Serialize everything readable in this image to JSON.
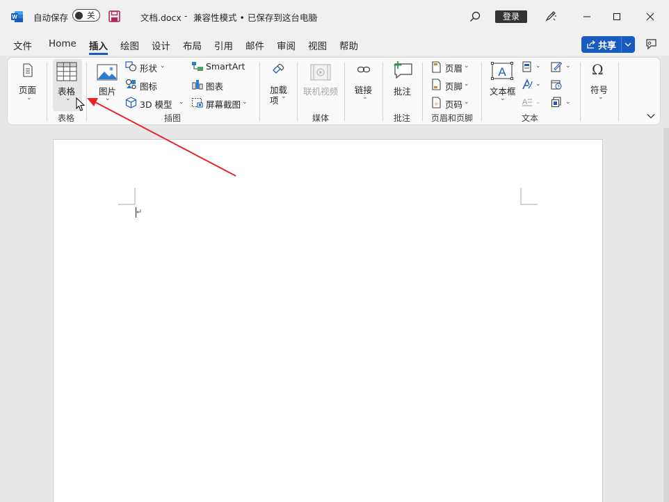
{
  "titlebar": {
    "autosave_label": "自动保存",
    "toggle_state": "关",
    "doc_title": "文档.docx",
    "dash": "-",
    "mode_status": "兼容性模式 • 已保存到这台电脑",
    "login": "登录"
  },
  "menu": {
    "items": [
      "文件",
      "Home",
      "插入",
      "绘图",
      "设计",
      "布局",
      "引用",
      "邮件",
      "审阅",
      "视图",
      "帮助"
    ],
    "active": "插入",
    "share": "共享"
  },
  "ribbon": {
    "pages": {
      "label": "页面"
    },
    "table": {
      "label": "表格",
      "group": "表格"
    },
    "illustrations": {
      "group": "插图",
      "picture": "图片",
      "shapes": "形状",
      "icons": "图标",
      "model3d": "3D 模型",
      "smartart": "SmartArt",
      "chart": "图表",
      "screenshot": "屏幕截图"
    },
    "addins": {
      "label_line1": "加载",
      "label_line2": "项"
    },
    "media": {
      "label": "联机视频",
      "group": "媒体"
    },
    "links": {
      "label": "链接"
    },
    "comments": {
      "label": "批注",
      "group": "批注"
    },
    "header_footer": {
      "group": "页眉和页脚",
      "header": "页眉",
      "footer": "页脚",
      "page_number": "页码"
    },
    "text": {
      "group": "文本",
      "textbox": "文本框"
    },
    "symbols": {
      "label": "符号"
    }
  },
  "colors": {
    "accent": "#185abd",
    "annotation_arrow": "#e8262a",
    "word_blue": "#185abd"
  }
}
